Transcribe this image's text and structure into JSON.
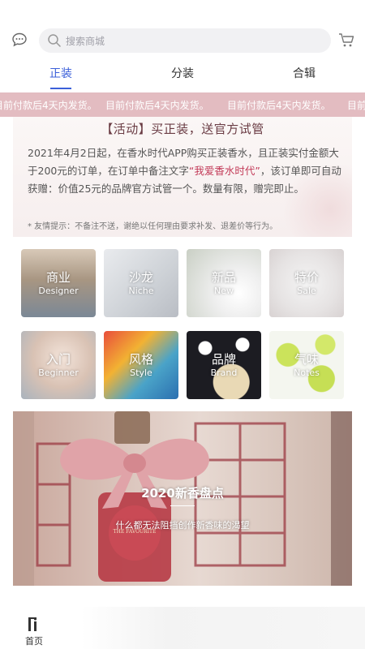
{
  "search": {
    "placeholder": "搜索商城"
  },
  "tabs": [
    {
      "label": "正装",
      "active": true
    },
    {
      "label": "分装",
      "active": false
    },
    {
      "label": "合辑",
      "active": false
    }
  ],
  "marquee": {
    "text": "目前付款后4天内发货。",
    "bg_color": "#e3bcc1"
  },
  "promo": {
    "title": "【活动】买正装，送官方试管",
    "body_pre": "2021年4月2日起，在香水时代APP购买正装香水，且正装实付金额大于200元的订单，在订单中备注文字",
    "body_highlight": "“我爱香水时代”",
    "body_post": "，该订单即可自动获赠：价值25元的品牌官方试管一个。数量有限，赠完即止。",
    "tip": "* 友情提示：不备注不送，谢绝以任何理由要求补发、退差价等行为。"
  },
  "categories": [
    {
      "zh": "商业",
      "en": "Designer"
    },
    {
      "zh": "沙龙",
      "en": "Niche"
    },
    {
      "zh": "新品",
      "en": "New"
    },
    {
      "zh": "特价",
      "en": "Sale"
    },
    {
      "zh": "入门",
      "en": "Beginner"
    },
    {
      "zh": "风格",
      "en": "Style"
    },
    {
      "zh": "品牌",
      "en": "Brand"
    },
    {
      "zh": "气味",
      "en": "Notes"
    }
  ],
  "banner": {
    "title": "2020新香盘点",
    "subtitle": "什么都无法阻挡创作新香味的渴望",
    "bottle_text": "THE FAVOURITE"
  },
  "bottom_nav": {
    "home_label": "首页"
  },
  "colors": {
    "accent": "#3b5fd9",
    "highlight": "#c23a58"
  },
  "icons": [
    "chat-icon",
    "search-icon",
    "cart-icon",
    "home-icon"
  ]
}
